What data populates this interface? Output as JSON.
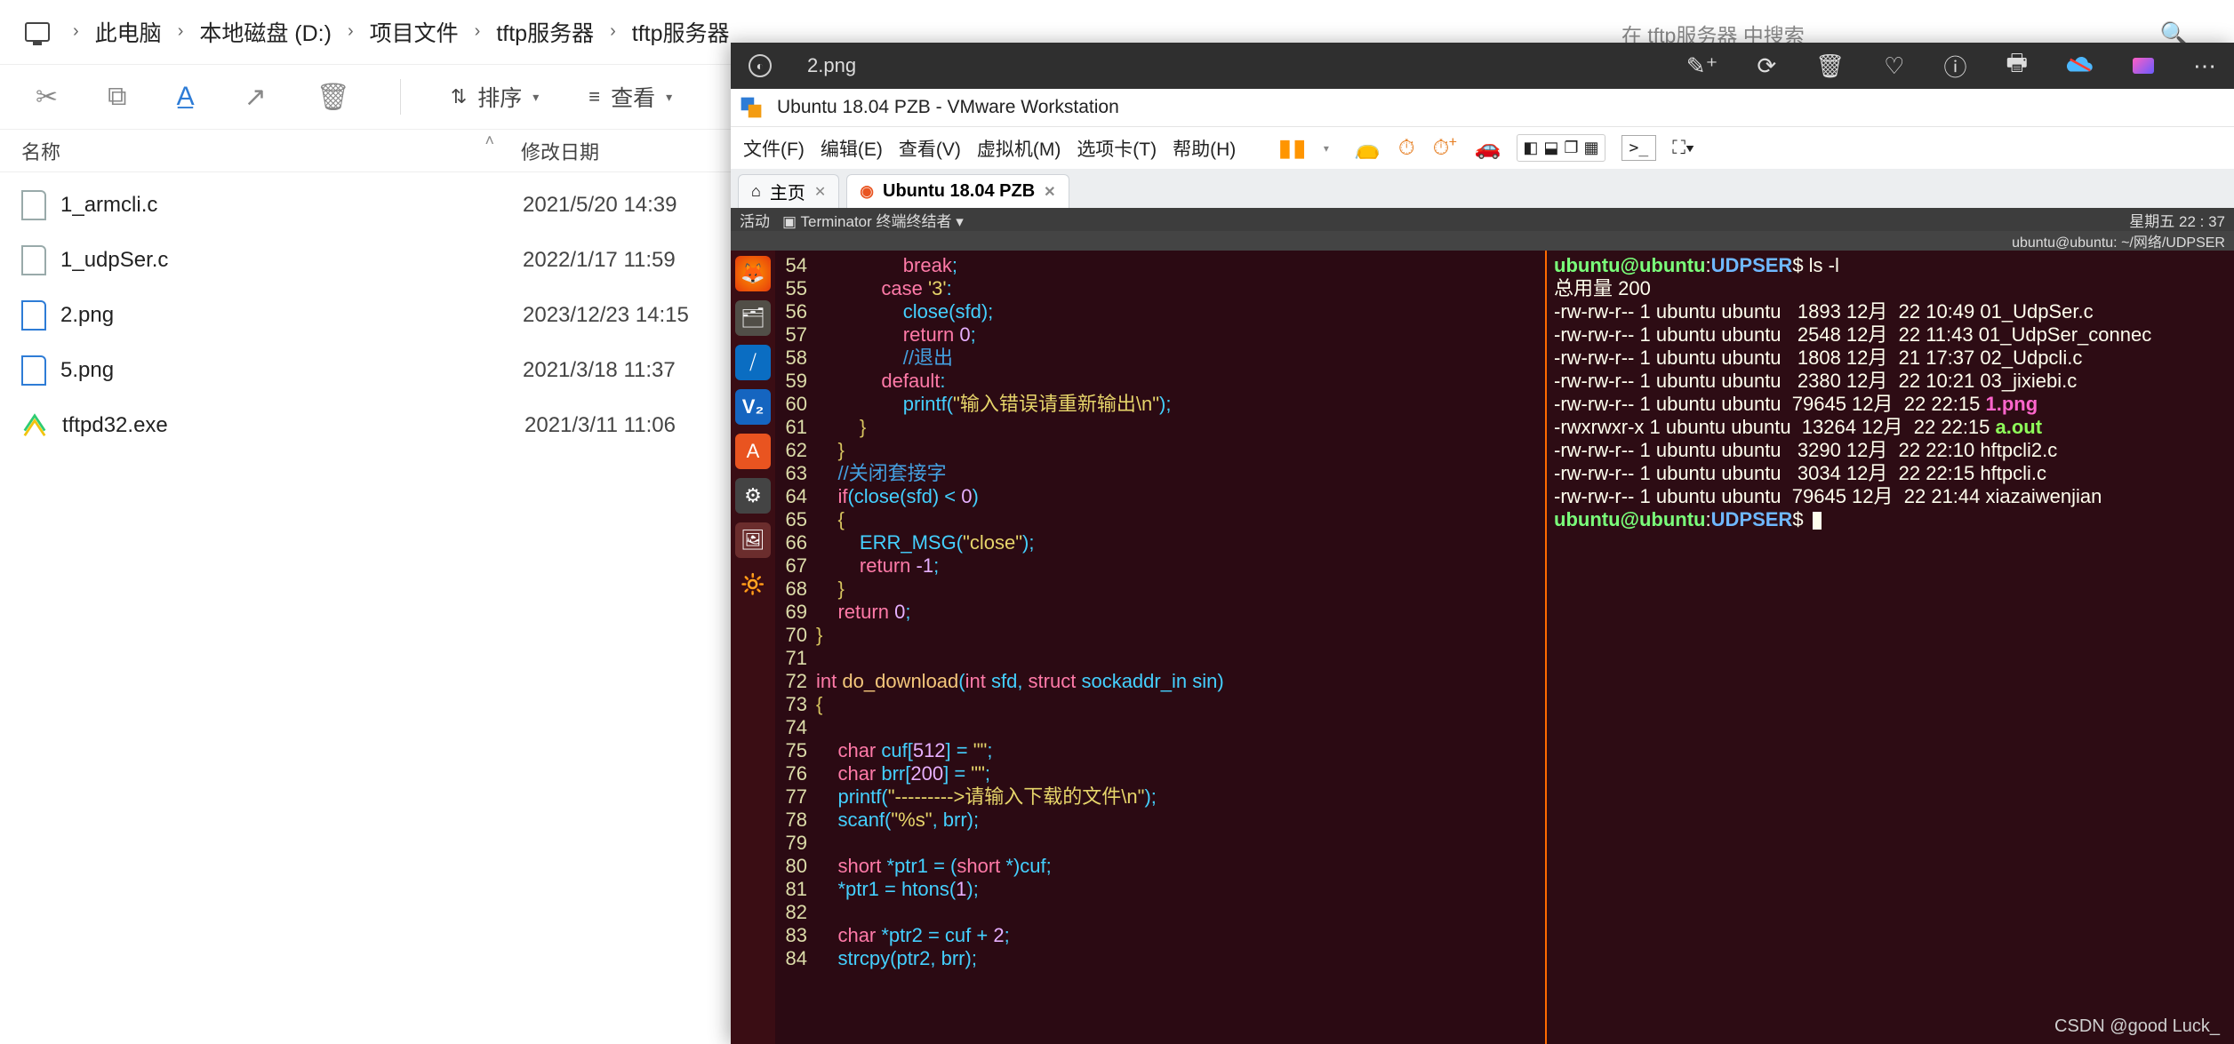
{
  "explorer": {
    "breadcrumb": [
      "此电脑",
      "本地磁盘 (D:)",
      "项目文件",
      "tftp服务器",
      "tftp服务器"
    ],
    "search_placeholder": "在 tftp服务器 中搜索",
    "sort_label": "排序",
    "view_label": "查看",
    "col_name": "名称",
    "col_date": "修改日期",
    "files": [
      {
        "name": "1_armcli.c",
        "date": "2021/5/20 14:39",
        "kind": "c"
      },
      {
        "name": "1_udpSer.c",
        "date": "2022/1/17 11:59",
        "kind": "c"
      },
      {
        "name": "2.png",
        "date": "2023/12/23 14:15",
        "kind": "img"
      },
      {
        "name": "5.png",
        "date": "2021/3/18 11:37",
        "kind": "img"
      },
      {
        "name": "tftpd32.exe",
        "date": "2021/3/11 11:06",
        "kind": "exe"
      }
    ]
  },
  "photo": {
    "title": "2.png"
  },
  "vmware": {
    "window_title": "Ubuntu 18.04 PZB - VMware Workstation",
    "menus": [
      "文件(F)",
      "编辑(E)",
      "查看(V)",
      "虚拟机(M)",
      "选项卡(T)",
      "帮助(H)"
    ],
    "tabs": [
      {
        "label": "主页",
        "active": false
      },
      {
        "label": "Ubuntu 18.04 PZB",
        "active": true
      }
    ]
  },
  "guest": {
    "activities": "活动",
    "terminator": "Terminator 终端终结者 ▾",
    "clock": "星期五 22 : 37",
    "cwd_label": "ubuntu@ubuntu: ~/网络/UDPSER"
  },
  "code": [
    {
      "n": 54,
      "html": "                <span class='c-kw'>break</span>;"
    },
    {
      "n": 55,
      "html": "            <span class='c-kw'>case</span> <span class='c-str'>'3'</span>:"
    },
    {
      "n": 56,
      "html": "                <span class='c-fn'>close</span>(sfd);"
    },
    {
      "n": 57,
      "html": "                <span class='c-kw'>return</span> <span class='c-num'>0</span>;"
    },
    {
      "n": 58,
      "html": "                <span class='c-cm'>//退出</span>"
    },
    {
      "n": 59,
      "html": "            <span class='c-kw'>default</span>:"
    },
    {
      "n": 60,
      "html": "                <span class='c-fn'>printf</span>(<span class='c-str'>\"输入错误请重新输出\\n\"</span>);"
    },
    {
      "n": 61,
      "html": "        <span class='c-br'>}</span>"
    },
    {
      "n": 62,
      "html": "    <span class='c-br'>}</span>"
    },
    {
      "n": 63,
      "html": "    <span class='c-cm'>//关闭套接字</span>"
    },
    {
      "n": 64,
      "html": "    <span class='c-kw'>if</span>(<span class='c-fn'>close</span>(sfd) &lt; <span class='c-num'>0</span>)"
    },
    {
      "n": 65,
      "html": "    <span class='c-br'>{</span>"
    },
    {
      "n": 66,
      "html": "        <span class='c-fn'>ERR_MSG</span>(<span class='c-str'>\"close\"</span>);"
    },
    {
      "n": 67,
      "html": "        <span class='c-kw'>return</span> <span class='c-num'>-1</span>;"
    },
    {
      "n": 68,
      "html": "    <span class='c-br'>}</span>"
    },
    {
      "n": 69,
      "html": "    <span class='c-kw'>return</span> <span class='c-num'>0</span>;"
    },
    {
      "n": 70,
      "html": "<span class='c-br'>}</span>"
    },
    {
      "n": 71,
      "html": ""
    },
    {
      "n": 72,
      "html": "<span class='c-kw'>int</span> <span class='c-def'>do_download</span>(<span class='c-kw'>int</span> sfd, <span class='c-kw'>struct</span> sockaddr_in sin)"
    },
    {
      "n": 73,
      "html": "<span class='c-br'>{</span>"
    },
    {
      "n": 74,
      "html": ""
    },
    {
      "n": 75,
      "html": "    <span class='c-kw'>char</span> cuf[<span class='c-num'>512</span>] = <span class='c-str'>\"\"</span>;"
    },
    {
      "n": 76,
      "html": "    <span class='c-kw'>char</span> brr[<span class='c-num'>200</span>] = <span class='c-str'>\"\"</span>;"
    },
    {
      "n": 77,
      "html": "    <span class='c-fn'>printf</span>(<span class='c-str'>\"---------&gt;请输入下载的文件\\n\"</span>);"
    },
    {
      "n": 78,
      "html": "    <span class='c-fn'>scanf</span>(<span class='c-str'>\"%s\"</span>, brr);"
    },
    {
      "n": 79,
      "html": ""
    },
    {
      "n": 80,
      "html": "    <span class='c-kw'>short</span> *ptr1 = (<span class='c-kw'>short</span> *)cuf;"
    },
    {
      "n": 81,
      "html": "    *ptr1 = <span class='c-fn'>htons</span>(<span class='c-num'>1</span>);"
    },
    {
      "n": 82,
      "html": ""
    },
    {
      "n": 83,
      "html": "    <span class='c-kw'>char</span> *ptr2 = cuf + <span class='c-num'>2</span>;"
    },
    {
      "n": 84,
      "html": "    <span class='c-fn'>strcpy</span>(ptr2, brr);"
    }
  ],
  "terminal": {
    "prompt_user": "ubuntu",
    "prompt_host": "ubuntu",
    "prompt_path": "UDPSER",
    "cmd": "ls -l",
    "total": "总用量 200",
    "rows": [
      {
        "perm": "-rw-rw-r--",
        "l": "1",
        "u": "ubuntu",
        "g": "ubuntu",
        "size": "  1893",
        "date": "12月  22 10:49",
        "name": "01_UdpSer.c"
      },
      {
        "perm": "-rw-rw-r--",
        "l": "1",
        "u": "ubuntu",
        "g": "ubuntu",
        "size": "  2548",
        "date": "12月  22 11:43",
        "name": "01_UdpSer_connec"
      },
      {
        "perm": "-rw-rw-r--",
        "l": "1",
        "u": "ubuntu",
        "g": "ubuntu",
        "size": "  1808",
        "date": "12月  21 17:37",
        "name": "02_Udpcli.c"
      },
      {
        "perm": "-rw-rw-r--",
        "l": "1",
        "u": "ubuntu",
        "g": "ubuntu",
        "size": "  2380",
        "date": "12月  22 10:21",
        "name": "03_jixiebi.c"
      },
      {
        "perm": "-rw-rw-r--",
        "l": "1",
        "u": "ubuntu",
        "g": "ubuntu",
        "size": " 79645",
        "date": "12月  22 22:15",
        "name": "1.png",
        "hl": "pink"
      },
      {
        "perm": "-rwxrwxr-x",
        "l": "1",
        "u": "ubuntu",
        "g": "ubuntu",
        "size": " 13264",
        "date": "12月  22 22:15",
        "name": "a.out",
        "hl": "green"
      },
      {
        "perm": "-rw-rw-r--",
        "l": "1",
        "u": "ubuntu",
        "g": "ubuntu",
        "size": "  3290",
        "date": "12月  22 22:10",
        "name": "hftpcli2.c"
      },
      {
        "perm": "-rw-rw-r--",
        "l": "1",
        "u": "ubuntu",
        "g": "ubuntu",
        "size": "  3034",
        "date": "12月  22 22:15",
        "name": "hftpcli.c"
      },
      {
        "perm": "-rw-rw-r--",
        "l": "1",
        "u": "ubuntu",
        "g": "ubuntu",
        "size": " 79645",
        "date": "12月  22 21:44",
        "name": "xiazaiwenjian"
      }
    ]
  },
  "watermark": "CSDN @good Luck_"
}
